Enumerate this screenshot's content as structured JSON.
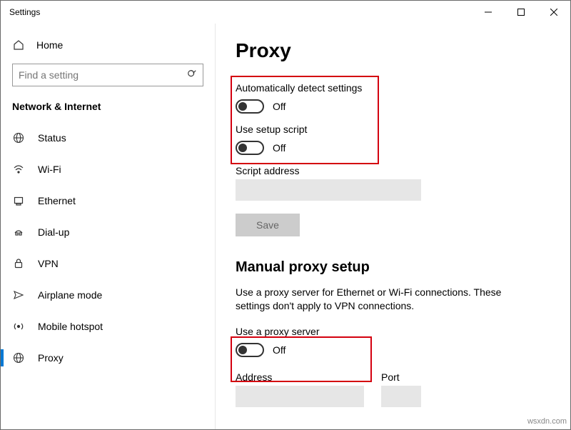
{
  "window_title": "Settings",
  "home_label": "Home",
  "search_placeholder": "Find a setting",
  "section": "Network & Internet",
  "nav": {
    "status": "Status",
    "wifi": "Wi-Fi",
    "ethernet": "Ethernet",
    "dialup": "Dial-up",
    "vpn": "VPN",
    "airplane": "Airplane mode",
    "hotspot": "Mobile hotspot",
    "proxy": "Proxy"
  },
  "page": {
    "title": "Proxy",
    "auto_detect_label": "Automatically detect settings",
    "auto_detect_state": "Off",
    "setup_script_label": "Use setup script",
    "setup_script_state": "Off",
    "script_address_label": "Script address",
    "save_label": "Save",
    "manual_heading": "Manual proxy setup",
    "manual_desc": "Use a proxy server for Ethernet or Wi-Fi connections. These settings don't apply to VPN connections.",
    "use_proxy_label": "Use a proxy server",
    "use_proxy_state": "Off",
    "address_label": "Address",
    "port_label": "Port"
  },
  "watermark": "wsxdn.com"
}
